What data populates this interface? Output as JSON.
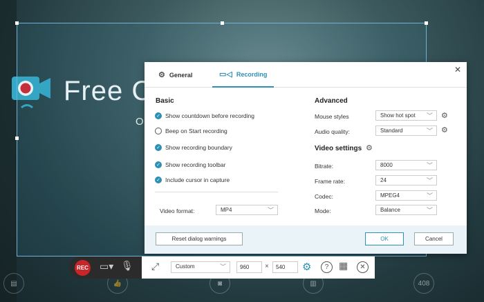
{
  "background": {
    "logo_text": "Free C",
    "subtitle": "O",
    "badge": "408"
  },
  "dialog": {
    "tabs": [
      {
        "label": "General"
      },
      {
        "label": "Recording"
      }
    ],
    "close": "✕",
    "basic": {
      "title": "Basic",
      "options": [
        {
          "label": "Show countdown before recording",
          "checked": true
        },
        {
          "label": "Beep on Start recording",
          "checked": false
        },
        {
          "label": "Show recording boundary",
          "checked": true
        },
        {
          "label": "Show recording toolbar",
          "checked": true
        },
        {
          "label": "Include cursor in capture",
          "checked": true
        }
      ],
      "video_format_label": "Video format:",
      "video_format": "MP4"
    },
    "advanced": {
      "title": "Advanced",
      "mouse_label": "Mouse styles",
      "mouse_value": "Show hot spot",
      "audio_label": "Audio quality:",
      "audio_value": "Standard"
    },
    "video": {
      "title": "Video settings",
      "bitrate_label": "Bitrate:",
      "bitrate": "8000",
      "framerate_label": "Frame rate:",
      "framerate": "24",
      "codec_label": "Codec:",
      "codec": "MPEG4",
      "mode_label": "Mode:",
      "mode": "Balance"
    },
    "footer": {
      "reset": "Reset dialog warnings",
      "ok": "OK",
      "cancel": "Cancel"
    }
  },
  "toolbar": {
    "rec": "REC",
    "preset": "Custom",
    "width": "960",
    "times": "×",
    "height": "540",
    "help": "?"
  },
  "colors": {
    "accent": "#2e8fb5",
    "rec": "#c8252b"
  }
}
